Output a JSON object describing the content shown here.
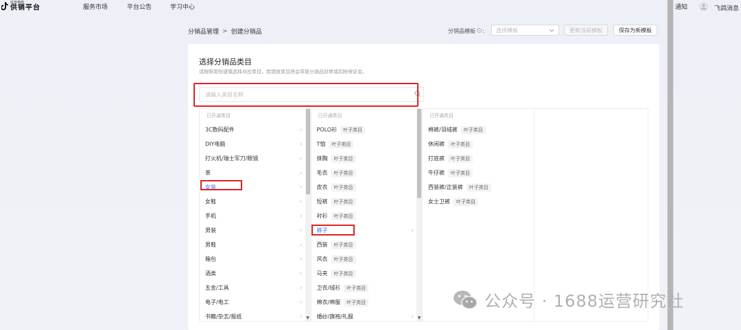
{
  "header": {
    "logo_sub": "抖音电商",
    "logo_main": "供销平台",
    "nav": [
      "服务市场",
      "平台公告",
      "学习中心"
    ],
    "notify_label": "通知",
    "feige_label": "飞鸽消息"
  },
  "breadcrumb": {
    "parent": "分销品管理",
    "separator": ">",
    "current": "创建分销品"
  },
  "template": {
    "label": "分销品模板",
    "select_placeholder": "选择模板",
    "update_button": "更新当前模板",
    "save_button": "保存为新模板"
  },
  "card": {
    "title": "选择分销品类目",
    "description": "请按照类别谨慎选择对应类目，若错放类目将会导致分销品封禁或扣除保证金。",
    "search_placeholder": "请输入类目名称"
  },
  "columns": {
    "head": "已开通类目",
    "leaf_tag": "叶子类目",
    "col1": [
      "3C数码配件",
      "DIY电脑",
      "打火机/瑞士军刀/眼镜",
      "茶",
      "女装",
      "女鞋",
      "手机",
      "男装",
      "男鞋",
      "箱包",
      "酒类",
      "五金/工具",
      "电子/电工",
      "书籍/杂志/报纸"
    ],
    "col1_selected": "女装",
    "col2": [
      {
        "label": "POLO衫",
        "leaf": true
      },
      {
        "label": "T恤",
        "leaf": true
      },
      {
        "label": "抹胸",
        "leaf": true
      },
      {
        "label": "毛衣",
        "leaf": true
      },
      {
        "label": "皮衣",
        "leaf": true
      },
      {
        "label": "短裤",
        "leaf": true
      },
      {
        "label": "衬衫",
        "leaf": true
      },
      {
        "label": "裤子",
        "leaf": false
      },
      {
        "label": "西装",
        "leaf": true
      },
      {
        "label": "风衣",
        "leaf": true
      },
      {
        "label": "马夹",
        "leaf": true
      },
      {
        "label": "卫衣/绒衫",
        "leaf": true
      },
      {
        "label": "棉衣/棉服",
        "leaf": true
      },
      {
        "label": "婚纱/旗袍/礼服",
        "leaf": false
      }
    ],
    "col2_selected": "裤子",
    "col3": [
      {
        "label": "棉裤/羽绒裤",
        "leaf": true
      },
      {
        "label": "休闲裤",
        "leaf": true
      },
      {
        "label": "打底裤",
        "leaf": true
      },
      {
        "label": "牛仔裤",
        "leaf": true
      },
      {
        "label": "西装裤/正装裤",
        "leaf": true
      },
      {
        "label": "女士卫裤",
        "leaf": true
      }
    ]
  },
  "watermark": {
    "text": "公众号 · 1688运营研究社"
  },
  "colors": {
    "accent": "#3b6fff",
    "highlight": "#e02020"
  }
}
